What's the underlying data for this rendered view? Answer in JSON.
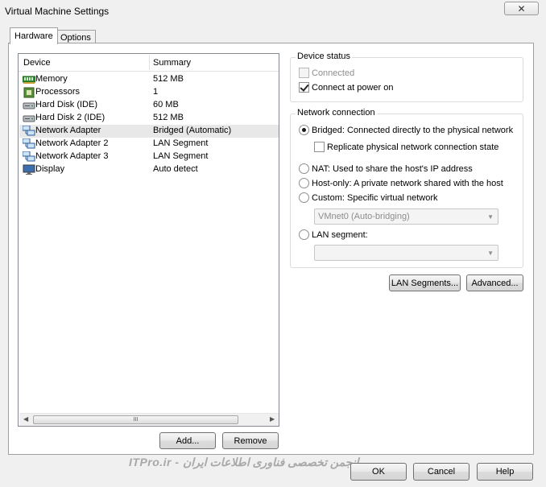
{
  "window": {
    "title": "Virtual Machine Settings",
    "close_glyph": "✕"
  },
  "tabs": [
    {
      "label": "Hardware",
      "active": true
    },
    {
      "label": "Options",
      "active": false
    }
  ],
  "device_list": {
    "columns": [
      "Device",
      "Summary"
    ],
    "rows": [
      {
        "device": "Memory",
        "summary": "512 MB",
        "icon": "memory-icon"
      },
      {
        "device": "Processors",
        "summary": "1",
        "icon": "processor-icon"
      },
      {
        "device": "Hard Disk (IDE)",
        "summary": "60 MB",
        "icon": "hard-disk-icon"
      },
      {
        "device": "Hard Disk 2 (IDE)",
        "summary": "512 MB",
        "icon": "hard-disk-icon"
      },
      {
        "device": "Network Adapter",
        "summary": "Bridged (Automatic)",
        "icon": "network-adapter-icon",
        "selected": true
      },
      {
        "device": "Network Adapter 2",
        "summary": "LAN Segment",
        "icon": "network-adapter-icon"
      },
      {
        "device": "Network Adapter 3",
        "summary": "LAN Segment",
        "icon": "network-adapter-icon"
      },
      {
        "device": "Display",
        "summary": "Auto detect",
        "icon": "display-icon"
      }
    ],
    "scroll_grip": "III"
  },
  "list_buttons": {
    "add": "Add...",
    "remove": "Remove"
  },
  "device_status": {
    "legend": "Device status",
    "connected": {
      "label": "Connected",
      "checked": false,
      "enabled": false
    },
    "connect_at_power_on": {
      "label": "Connect at power on",
      "checked": true,
      "enabled": true
    }
  },
  "network_connection": {
    "legend": "Network connection",
    "bridged": "Bridged: Connected directly to the physical network",
    "replicate": "Replicate physical network connection state",
    "nat": "NAT: Used to share the host's IP address",
    "host_only": "Host-only: A private network shared with the host",
    "custom": "Custom: Specific virtual network",
    "custom_select": "VMnet0 (Auto-bridging)",
    "lan_segment": "LAN segment:",
    "lan_segment_select": "",
    "selected": "bridged"
  },
  "net_buttons": {
    "lan_segments": "LAN Segments...",
    "advanced": "Advanced..."
  },
  "footer": {
    "ok": "OK",
    "cancel": "Cancel",
    "help": "Help"
  },
  "watermark": "ITPro.ir - انجمن تخصصی فناوری اطلاعات ایران"
}
